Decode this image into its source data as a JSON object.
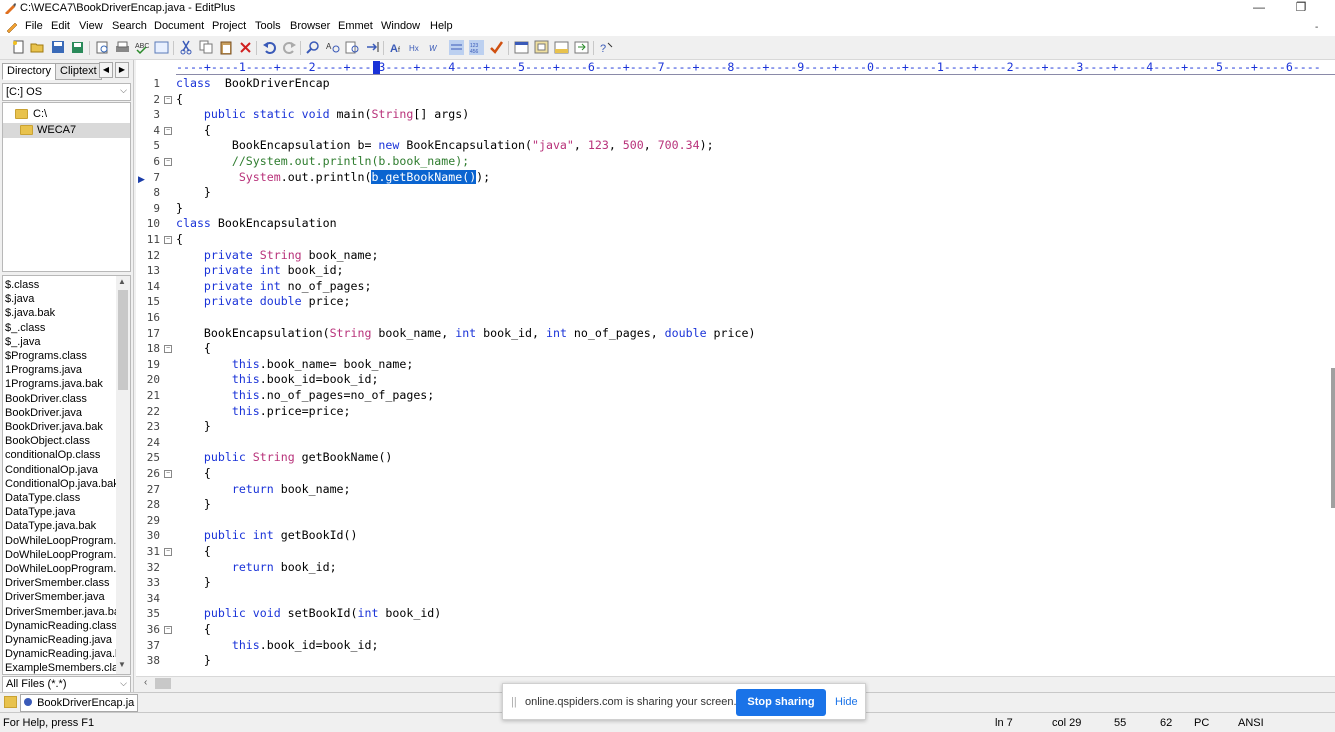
{
  "window": {
    "title": "C:\\WECA7\\BookDriverEncap.java - EditPlus",
    "minimize_label": "—",
    "restore_label": "❐"
  },
  "menu": [
    "File",
    "Edit",
    "View",
    "Search",
    "Document",
    "Project",
    "Tools",
    "Browser",
    "Emmet",
    "Window",
    "Help"
  ],
  "mdi": {
    "min_label": "-",
    "close_label": "x"
  },
  "left_panel": {
    "tabs": [
      "Directory",
      "Cliptext"
    ],
    "drive": "[C:] OS",
    "tree": [
      {
        "label": "C:\\"
      },
      {
        "label": "WECA7",
        "selected": true
      }
    ],
    "files": [
      "$.class",
      "$.java",
      "$.java.bak",
      "$_.class",
      "$_.java",
      "$Programs.class",
      "1Programs.java",
      "1Programs.java.bak",
      "BookDriver.class",
      "BookDriver.java",
      "BookDriver.java.bak",
      "BookObject.class",
      "conditionalOp.class",
      "ConditionalOp.java",
      "ConditionalOp.java.bak",
      "DataType.class",
      "DataType.java",
      "DataType.java.bak",
      "DoWhileLoopProgram.c",
      "DoWhileLoopProgram.j",
      "DoWhileLoopProgram.j",
      "DriverSmember.class",
      "DriverSmember.java",
      "DriverSmember.java.bal",
      "DynamicReading.class",
      "DynamicReading.java",
      "DynamicReading.java.b",
      "ExampleSmembers.class"
    ],
    "filter": "All Files (*.*)"
  },
  "ruler": "----+----1----+----2----+----3----+----4----+----5----+----6----+----7----+----8----+----9----+----0----+----1----+----2----+----3----+----4----+----5----+----6----",
  "editor": {
    "lines": [
      {
        "n": "1",
        "t": [
          [
            "kw",
            "class"
          ],
          [
            "",
            "  BookDriverEncap"
          ]
        ]
      },
      {
        "n": "2",
        "f": "⊟",
        "t": [
          [
            "",
            "{"
          ]
        ]
      },
      {
        "n": "3",
        "t": [
          [
            "",
            "    "
          ],
          [
            "kw",
            "public static void"
          ],
          [
            "",
            " main("
          ],
          [
            "st",
            "String"
          ],
          [
            "",
            "[] args)"
          ]
        ]
      },
      {
        "n": "4",
        "f": "⊟",
        "t": [
          [
            "",
            "    {"
          ]
        ]
      },
      {
        "n": "5",
        "t": [
          [
            "",
            "        BookEncapsulation b= "
          ],
          [
            "kw",
            "new"
          ],
          [
            "",
            " BookEncapsulation("
          ],
          [
            "st",
            "\"java\""
          ],
          [
            "",
            ", "
          ],
          [
            "nm",
            "123"
          ],
          [
            "",
            ", "
          ],
          [
            "nm",
            "500"
          ],
          [
            "",
            ", "
          ],
          [
            "nm",
            "700.34"
          ],
          [
            "",
            ");"
          ]
        ]
      },
      {
        "n": "6",
        "f": "⊟",
        "t": [
          [
            "",
            "        "
          ],
          [
            "cm",
            "//System.out.println(b.book_name);"
          ]
        ]
      },
      {
        "n": "7",
        "t": [
          [
            "",
            "         "
          ],
          [
            "st",
            "System"
          ],
          [
            "",
            ".out.println("
          ],
          [
            "sel",
            "b.getBookName()"
          ],
          [
            "",
            ");"
          ]
        ]
      },
      {
        "n": "8",
        "t": [
          [
            "",
            "    }"
          ]
        ]
      },
      {
        "n": "9",
        "t": [
          [
            "",
            "}"
          ]
        ]
      },
      {
        "n": "10",
        "t": [
          [
            "kw",
            "class"
          ],
          [
            "",
            " BookEncapsulation"
          ]
        ]
      },
      {
        "n": "11",
        "f": "⊟",
        "t": [
          [
            "",
            "{"
          ]
        ]
      },
      {
        "n": "12",
        "t": [
          [
            "",
            "    "
          ],
          [
            "kw",
            "private"
          ],
          [
            "",
            " "
          ],
          [
            "st",
            "String"
          ],
          [
            "",
            " book_name;"
          ]
        ]
      },
      {
        "n": "13",
        "t": [
          [
            "",
            "    "
          ],
          [
            "kw",
            "private int"
          ],
          [
            "",
            " book_id;"
          ]
        ]
      },
      {
        "n": "14",
        "t": [
          [
            "",
            "    "
          ],
          [
            "kw",
            "private int"
          ],
          [
            "",
            " no_of_pages;"
          ]
        ]
      },
      {
        "n": "15",
        "t": [
          [
            "",
            "    "
          ],
          [
            "kw",
            "private double"
          ],
          [
            "",
            " price;"
          ]
        ]
      },
      {
        "n": "16",
        "t": []
      },
      {
        "n": "17",
        "t": [
          [
            "",
            "    BookEncapsulation("
          ],
          [
            "st",
            "String"
          ],
          [
            "",
            " book_name, "
          ],
          [
            "kw",
            "int"
          ],
          [
            "",
            " book_id, "
          ],
          [
            "kw",
            "int"
          ],
          [
            "",
            " no_of_pages, "
          ],
          [
            "kw",
            "double"
          ],
          [
            "",
            " price)"
          ]
        ]
      },
      {
        "n": "18",
        "f": "⊟",
        "t": [
          [
            "",
            "    {"
          ]
        ]
      },
      {
        "n": "19",
        "t": [
          [
            "",
            "        "
          ],
          [
            "kw",
            "this"
          ],
          [
            "",
            ".book_name= book_name;"
          ]
        ]
      },
      {
        "n": "20",
        "t": [
          [
            "",
            "        "
          ],
          [
            "kw",
            "this"
          ],
          [
            "",
            ".book_id=book_id;"
          ]
        ]
      },
      {
        "n": "21",
        "t": [
          [
            "",
            "        "
          ],
          [
            "kw",
            "this"
          ],
          [
            "",
            ".no_of_pages=no_of_pages;"
          ]
        ]
      },
      {
        "n": "22",
        "t": [
          [
            "",
            "        "
          ],
          [
            "kw",
            "this"
          ],
          [
            "",
            ".price=price;"
          ]
        ]
      },
      {
        "n": "23",
        "t": [
          [
            "",
            "    }"
          ]
        ]
      },
      {
        "n": "24",
        "t": []
      },
      {
        "n": "25",
        "t": [
          [
            "",
            "    "
          ],
          [
            "kw",
            "public"
          ],
          [
            "",
            " "
          ],
          [
            "st",
            "String"
          ],
          [
            "",
            " getBookName()"
          ]
        ]
      },
      {
        "n": "26",
        "f": "⊟",
        "t": [
          [
            "",
            "    {"
          ]
        ]
      },
      {
        "n": "27",
        "t": [
          [
            "",
            "        "
          ],
          [
            "kw",
            "return"
          ],
          [
            "",
            " book_name;"
          ]
        ]
      },
      {
        "n": "28",
        "t": [
          [
            "",
            "    }"
          ]
        ]
      },
      {
        "n": "29",
        "t": []
      },
      {
        "n": "30",
        "t": [
          [
            "",
            "    "
          ],
          [
            "kw",
            "public int"
          ],
          [
            "",
            " getBookId()"
          ]
        ]
      },
      {
        "n": "31",
        "f": "⊟",
        "t": [
          [
            "",
            "    {"
          ]
        ]
      },
      {
        "n": "32",
        "t": [
          [
            "",
            "        "
          ],
          [
            "kw",
            "return"
          ],
          [
            "",
            " book_id;"
          ]
        ]
      },
      {
        "n": "33",
        "t": [
          [
            "",
            "    }"
          ]
        ]
      },
      {
        "n": "34",
        "t": []
      },
      {
        "n": "35",
        "t": [
          [
            "",
            "    "
          ],
          [
            "kw",
            "public void"
          ],
          [
            "",
            " setBookId("
          ],
          [
            "kw",
            "int"
          ],
          [
            "",
            " book_id)"
          ]
        ]
      },
      {
        "n": "36",
        "f": "⊟",
        "t": [
          [
            "",
            "    {"
          ]
        ]
      },
      {
        "n": "37",
        "t": [
          [
            "",
            "        "
          ],
          [
            "kw",
            "this"
          ],
          [
            "",
            ".book_id=book_id;"
          ]
        ]
      },
      {
        "n": "38",
        "t": [
          [
            "",
            "    }"
          ]
        ]
      }
    ]
  },
  "doc_tab": {
    "label": "BookDriverEncap.ja",
    "close": "×"
  },
  "status": {
    "help": "For Help, press F1",
    "line": "ln 7",
    "col": "col 29",
    "v1": "55",
    "v2": "62",
    "mode": "PC",
    "enc": "ANSI"
  },
  "share_bar": {
    "grip": "||",
    "text": "online.qspiders.com is sharing your screen.",
    "stop": "Stop sharing",
    "hide": "Hide"
  },
  "colors": {
    "keyword": "#1a33d8",
    "string": "#b8327a",
    "comment": "#2e7c2e",
    "selection": "#0a64d0",
    "share_button": "#1a73e8"
  }
}
